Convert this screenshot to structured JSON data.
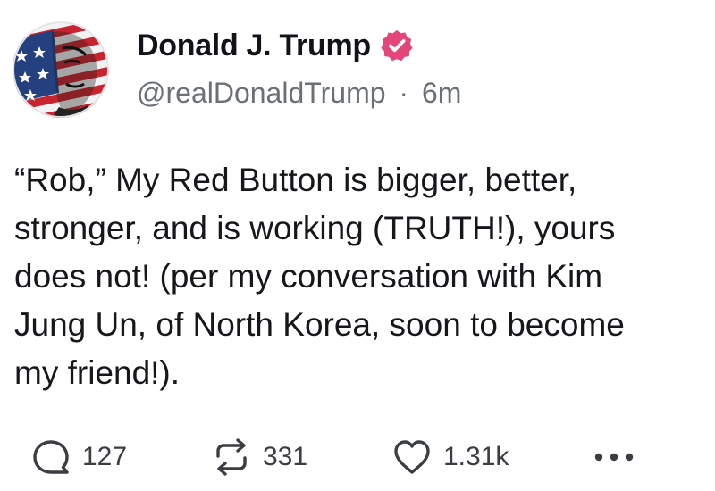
{
  "post": {
    "author": {
      "display_name": "Donald J. Trump",
      "handle": "@realDonaldTrump",
      "separator": "·",
      "timestamp": "6m",
      "verified": true,
      "verified_color": "#e5467a"
    },
    "text": "“Rob,” My Red Button is bigger, better,\nstronger, and is working (TRUTH!), yours\ndoes not! (per my conversation with Kim\nJung Un, of North Korea, soon to become\nmy friend!).",
    "actions": {
      "reply_icon": "reply-icon",
      "reply_count": "127",
      "retruth_icon": "retruth-icon",
      "retruth_count": "331",
      "like_icon": "heart-icon",
      "like_count": "1.31k",
      "more_icon": "more-options-icon"
    }
  },
  "colors": {
    "text_primary": "#15171b",
    "text_secondary": "#6b6f76",
    "icon": "#3a3d42",
    "background": "#ffffff"
  }
}
